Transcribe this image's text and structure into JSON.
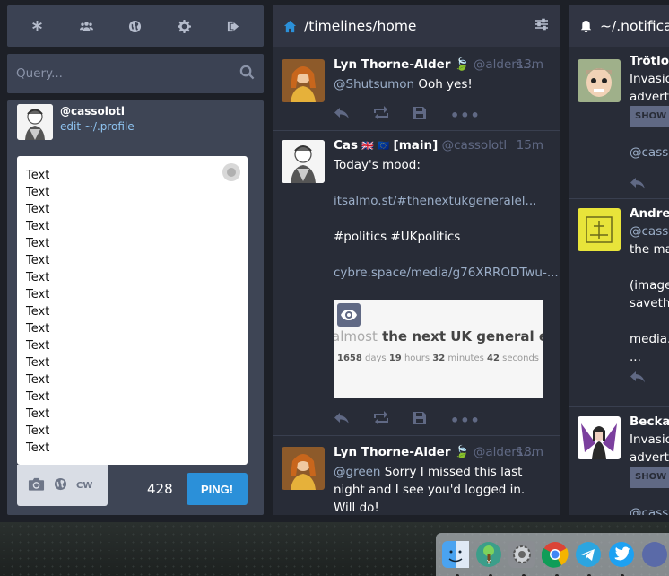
{
  "compose": {
    "search_placeholder": "Query...",
    "handle": "@cassolotl",
    "edit_profile": "edit ~/.profile",
    "lines": [
      "Text",
      "Text",
      "Text",
      "Text",
      "Text",
      "Text",
      "Text",
      "Text",
      "Text",
      "Text",
      "Text",
      "Text",
      "Text",
      "Text",
      "Text",
      "Text",
      "Text"
    ],
    "cw_label": "CW",
    "char_count": "428",
    "submit_label": "PING!"
  },
  "home": {
    "title": "/timelines/home",
    "statuses": [
      {
        "name": "Lyn Thorne-Alder",
        "handle": "@alders...",
        "time": "13m",
        "mention": "@Shutsumon",
        "text": " Ooh yes!"
      },
      {
        "name": "Cas",
        "flags": "🇬🇧 🇪🇺",
        "tag": "[main]",
        "handle": "@cassolotl",
        "time": "15m",
        "para1": "Today's mood:",
        "para2": "itsalmo.st/#thenextukgeneralel...",
        "para3": "#politics #UKpolitics",
        "para4": "cybre.space/media/g76XRRODTwu-...",
        "media_headline_light": "almost",
        "media_headline": " the next UK general electi",
        "media_counter": [
          {
            "n": "1658",
            "u": "days"
          },
          {
            "n": "19",
            "u": "hours"
          },
          {
            "n": "32",
            "u": "minutes"
          },
          {
            "n": "42",
            "u": "seconds"
          }
        ]
      },
      {
        "name": "Lyn Thorne-Alder",
        "handle": "@alders...",
        "time": "18m",
        "mention": "@green",
        "text": " Sorry I missed this last night and I see you'd logged in. Will do!"
      }
    ]
  },
  "notifications": {
    "title": "~/.notifications",
    "items": [
      {
        "name": "Trötlor",
        "line1": "Invasio",
        "line2": "adverti",
        "show_more": "SHOW M",
        "tail": "@cass"
      },
      {
        "name": "Andrew",
        "line1": "@casso",
        "line2": "the ma",
        "line3": "(image",
        "line4": "saveth",
        "line5": "media.",
        "line6": "..."
      },
      {
        "name": "Becka",
        "line1": "Invasio",
        "line2": "adverti",
        "show_more": "SHOW M",
        "tail": "@cass"
      }
    ]
  },
  "colors": {
    "accent": "#2b90d9",
    "column_bg": "#282c37",
    "header_bg": "#313543",
    "muted": "#606984"
  }
}
